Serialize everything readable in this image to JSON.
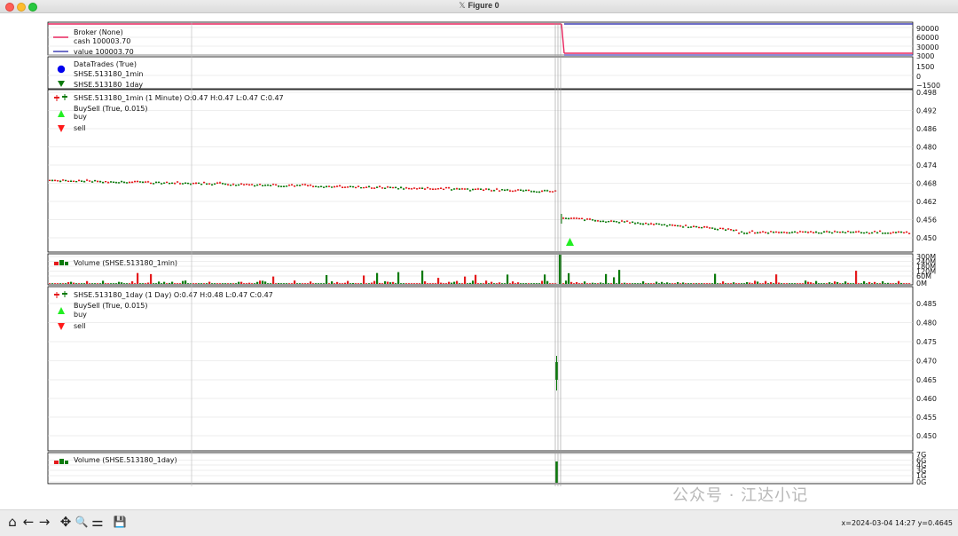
{
  "window": {
    "title": "Figure 0",
    "x_icon": "X11-icon"
  },
  "panels": {
    "broker": {
      "legend": [
        "Broker (None)",
        "cash 100003.70",
        "value 100003.70"
      ],
      "ticks": [
        "90000",
        "60000",
        "30000",
        "3000"
      ],
      "colors": {
        "cash": "#e8265f",
        "value": "#1a1aa8"
      }
    },
    "trades": {
      "legend": [
        "DataTrades (True)",
        "SHSE.513180_1min",
        "SHSE.513180_1day"
      ],
      "ticks": [
        "1500",
        "0",
        "−1500"
      ]
    },
    "price_1min": {
      "legend": [
        "SHSE.513180_1min (1 Minute) O:0.47 H:0.47 L:0.47 C:0.47",
        "BuySell (True, 0.015)",
        "buy",
        "sell"
      ],
      "ticks": [
        "0.498",
        "0.492",
        "0.486",
        "0.480",
        "0.474",
        "0.468",
        "0.462",
        "0.456",
        "0.450"
      ]
    },
    "volume_1min": {
      "legend": [
        "Volume (SHSE.513180_1min)"
      ],
      "ticks": [
        "300M",
        "240M",
        "180M",
        "120M",
        "60M",
        "0M"
      ]
    },
    "price_1day": {
      "legend": [
        "SHSE.513180_1day (1 Day) O:0.47 H:0.48 L:0.47 C:0.47",
        "BuySell (True, 0.015)",
        "buy",
        "sell"
      ],
      "ticks": [
        "0.485",
        "0.480",
        "0.475",
        "0.470",
        "0.465",
        "0.460",
        "0.455",
        "0.450"
      ]
    },
    "volume_1day": {
      "legend": [
        "Volume (SHSE.513180_1day)"
      ],
      "ticks": [
        "7G",
        "6G",
        "4G",
        "3G",
        "1G",
        "0G"
      ]
    }
  },
  "colors": {
    "up": "#e41a1c",
    "down": "#0b7a0b",
    "buy_marker": "#22ee22",
    "sell_marker": "#ff1a1a",
    "trade_dot": "#0000ee"
  },
  "toolbar": {
    "home": "⌂",
    "back": "←",
    "forward": "→",
    "pan": "✥",
    "zoom": "🔍",
    "configure": "⚌",
    "save": "💾"
  },
  "status": {
    "coords": "x=2024-03-04 14:27 y=0.4645"
  },
  "watermark": {
    "text": "公众号 · 江达小记"
  }
}
